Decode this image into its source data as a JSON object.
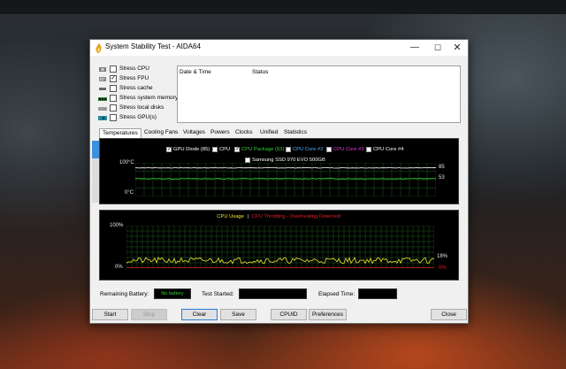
{
  "window": {
    "title": "System Stability Test - AIDA64",
    "controls": {
      "minimize": "—",
      "maximize": "☐",
      "close": "✕"
    }
  },
  "stress": {
    "items": [
      {
        "label": "Stress CPU",
        "checked": false,
        "icon": "cpu-chip-icon"
      },
      {
        "label": "Stress FPU",
        "checked": true,
        "icon": "fpu-chip-icon"
      },
      {
        "label": "Stress cache",
        "checked": false,
        "icon": "cache-icon"
      },
      {
        "label": "Stress system memory",
        "checked": false,
        "icon": "memory-icon"
      },
      {
        "label": "Stress local disks",
        "checked": false,
        "icon": "disk-icon"
      },
      {
        "label": "Stress GPU(s)",
        "checked": false,
        "icon": "gpu-icon"
      }
    ]
  },
  "log": {
    "col_datetime": "Date & Time",
    "col_status": "Status"
  },
  "tabs": [
    {
      "label": "Temperatures",
      "active": true
    },
    {
      "label": "Cooling Fans",
      "active": false
    },
    {
      "label": "Voltages",
      "active": false
    },
    {
      "label": "Powers",
      "active": false
    },
    {
      "label": "Clocks",
      "active": false
    },
    {
      "label": "Unified",
      "active": false
    },
    {
      "label": "Statistics",
      "active": false
    }
  ],
  "temp_graph": {
    "legend": [
      {
        "label": "GPU Diode (85)",
        "checked": true,
        "color": "#ffffff"
      },
      {
        "label": "CPU",
        "checked": false,
        "color": "#ffffff"
      },
      {
        "label": "CPU Package (53)",
        "checked": true,
        "color": "#2fd12f"
      },
      {
        "label": "CPU Core #2",
        "checked": false,
        "color": "#4fb3ff"
      },
      {
        "label": "CPU Core #3",
        "checked": false,
        "color": "#e040e0"
      },
      {
        "label": "CPU Core #4",
        "checked": false,
        "color": "#ffffff"
      },
      {
        "label": "Samsung SSD 970 EVO 500GB",
        "checked": false,
        "color": "#ffffff"
      }
    ],
    "y_top": "100°C",
    "y_bottom": "0°C",
    "value_gpu": "85",
    "value_cpu_pkg": "53",
    "gpu_level": 85,
    "cpu_pkg_level": 53,
    "gpu_color": "#ffffff",
    "cpu_pkg_color": "#2fd12f"
  },
  "cpu_graph": {
    "title_usage": "CPU Usage",
    "separator": "|",
    "title_throttle": "CPU Throttling - Overheating Detected!",
    "usage_color": "#f2e830",
    "throttle_color": "#e02020",
    "y_top": "100%",
    "y_bottom": "0%",
    "value_usage": "18%",
    "value_throttle": "0%",
    "usage_level": 18
  },
  "status": {
    "battery_label": "Remaining Battery:",
    "battery_value": "No battery",
    "test_started_label": "Test Started:",
    "elapsed_label": "Elapsed Time:"
  },
  "buttons": {
    "start": "Start",
    "stop": "Stop",
    "clear": "Clear",
    "save": "Save",
    "cpuid": "CPUID",
    "preferences": "Preferences",
    "close": "Close"
  }
}
